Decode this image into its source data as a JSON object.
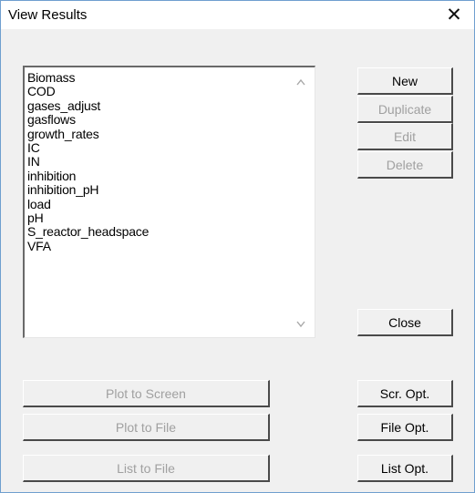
{
  "window": {
    "title": "View Results",
    "close_glyph": "✕"
  },
  "results_list": {
    "items": [
      "Biomass",
      "COD",
      "gases_adjust",
      "gasflows",
      "growth_rates",
      "IC",
      "IN",
      "inhibition",
      "inhibition_pH",
      "load",
      "pH",
      "S_reactor_headspace",
      "VFA"
    ]
  },
  "buttons": {
    "new": "New",
    "duplicate": "Duplicate",
    "edit": "Edit",
    "delete": "Delete",
    "close": "Close",
    "plot_to_screen": "Plot to Screen",
    "plot_to_file": "Plot to File",
    "list_to_file": "List to File",
    "scr_opt": "Scr. Opt.",
    "file_opt": "File Opt.",
    "list_opt": "List Opt."
  },
  "icons": {
    "scroll_up": "chevron-up-icon",
    "scroll_down": "chevron-down-icon",
    "close": "close-icon"
  },
  "colors": {
    "window_border": "#6f9fcf",
    "dialog_bg": "#f0f0f0",
    "disabled_text": "#a0a0a0"
  }
}
